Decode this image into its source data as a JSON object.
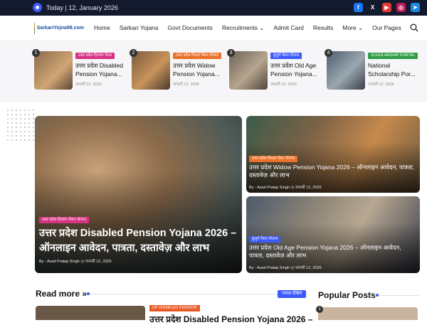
{
  "topbar": {
    "date": "Today | 12, January 2026",
    "social": [
      {
        "icon": "facebook-icon",
        "glyph": "f",
        "color": "#1877f2"
      },
      {
        "icon": "x-icon",
        "glyph": "X",
        "color": "#141a2e"
      },
      {
        "icon": "youtube-icon",
        "glyph": "▶",
        "color": "#e53935"
      },
      {
        "icon": "instagram-icon",
        "glyph": "◎",
        "color": "#c2185b"
      },
      {
        "icon": "telegram-icon",
        "glyph": "➤",
        "color": "#1e88e5"
      }
    ]
  },
  "nav": {
    "logo_text": "SarkariYojna99.com",
    "items": [
      "Home",
      "Sarkari Yojana",
      "Govt Documents",
      "Recruitments ⌄",
      "Admit Card",
      "Results",
      "More ⌄",
      "Our Pages"
    ]
  },
  "ticker": [
    {
      "num": "1",
      "badge": "उत्तर प्रदेश दिव्यांग पेंशन",
      "badge_color": "#d63384",
      "title": "उत्तर प्रदेश Disabled Pension Yojana...",
      "date": "जनवरी 12, 2026"
    },
    {
      "num": "2",
      "badge": "उत्तर प्रदेश विधवा पेंशन योजना",
      "badge_color": "#e8702a",
      "title": "उत्तर प्रदेश Widow Pension Yojana...",
      "date": "जनवरी 12, 2026"
    },
    {
      "num": "3",
      "badge": "बुजुर्ग पेंशन योजना",
      "badge_color": "#3d5afe",
      "title": "उत्तर प्रदेश Old Age Pension Yojana...",
      "date": "जनवरी 12, 2026"
    },
    {
      "num": "4",
      "badge": "SCHOLARSHIP PORTAL",
      "badge_color": "#2e9d44",
      "title": "National Scholarship Por...",
      "date": "जनवरी 12, 2026"
    }
  ],
  "hero": {
    "main": {
      "badge": "उत्तर प्रदेश दिव्यांग पेंशन योजना",
      "title": "उत्तर प्रदेश Disabled Pension Yojana 2026 – ऑनलाइन आवेदन, पात्रता, दस्तावेज़ और लाभ",
      "meta": "By - Azad Pratap Singh  ◷ जनवरी 12, 2026"
    },
    "side": [
      {
        "badge": "उत्तर प्रदेश विधवा पेंशन योजना",
        "badge_color": "#e8702a",
        "title": "उत्तर प्रदेश Widow Pension Yojana 2026 – ऑनलाइन आवेदन, पात्रता, दस्तावेज़ और लाभ",
        "meta": "By - Azad Pratap Singh  ◷ जनवरी 12, 2026"
      },
      {
        "badge": "बुजुर्ग पेंशन योजना",
        "badge_color": "#3d5afe",
        "title": "उत्तर प्रदेश Old Age Pension Yojana 2026 – ऑनलाइन आवेदन, पात्रता, दस्तावेज़ और लाभ",
        "meta": "By - Azad Pratap Singh  ◷ जनवरी 12, 2026"
      }
    ]
  },
  "sections": {
    "read_more": "Read more »",
    "read_more_tag": "ज्यादा देखिये",
    "popular": "Popular Posts"
  },
  "bottom": {
    "badge": "UP DISABLED PENSION",
    "title": "उत्तर प्रदेश Disabled Pension Yojana 2026 –",
    "pop_num": "1"
  }
}
